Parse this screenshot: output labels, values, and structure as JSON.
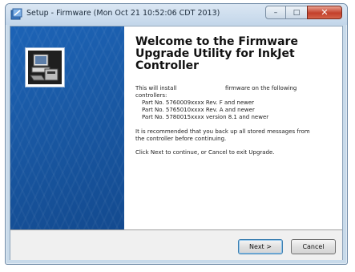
{
  "window": {
    "title": "Setup - Firmware (Mon Oct 21 10:52:06 CDT 2013)",
    "minimize_glyph": "–",
    "maximize_glyph": "□",
    "close_glyph": "✕"
  },
  "content": {
    "heading_lines": [
      "Welcome to the Firmware",
      "Upgrade Utility for InkJet",
      "Controller"
    ],
    "intro_a": "This will install",
    "intro_b": "firmware on the following",
    "intro_c": "controllers:",
    "parts": [
      "Part No. 5760009xxxx Rev. F and newer",
      "Part No. 5765010xxxx Rev. A and newer",
      "Part No. 5780015xxxx version 8.1 and newer"
    ],
    "recommend_1": "It is recommended that you back up all stored messages from",
    "recommend_2": "the controller before continuing.",
    "instruction": "Click Next to continue, or Cancel to exit Upgrade."
  },
  "buttons": {
    "next": "Next >",
    "cancel": "Cancel"
  },
  "colors": {
    "side_panel": "#1a5aa6",
    "close_button": "#c3402b"
  }
}
